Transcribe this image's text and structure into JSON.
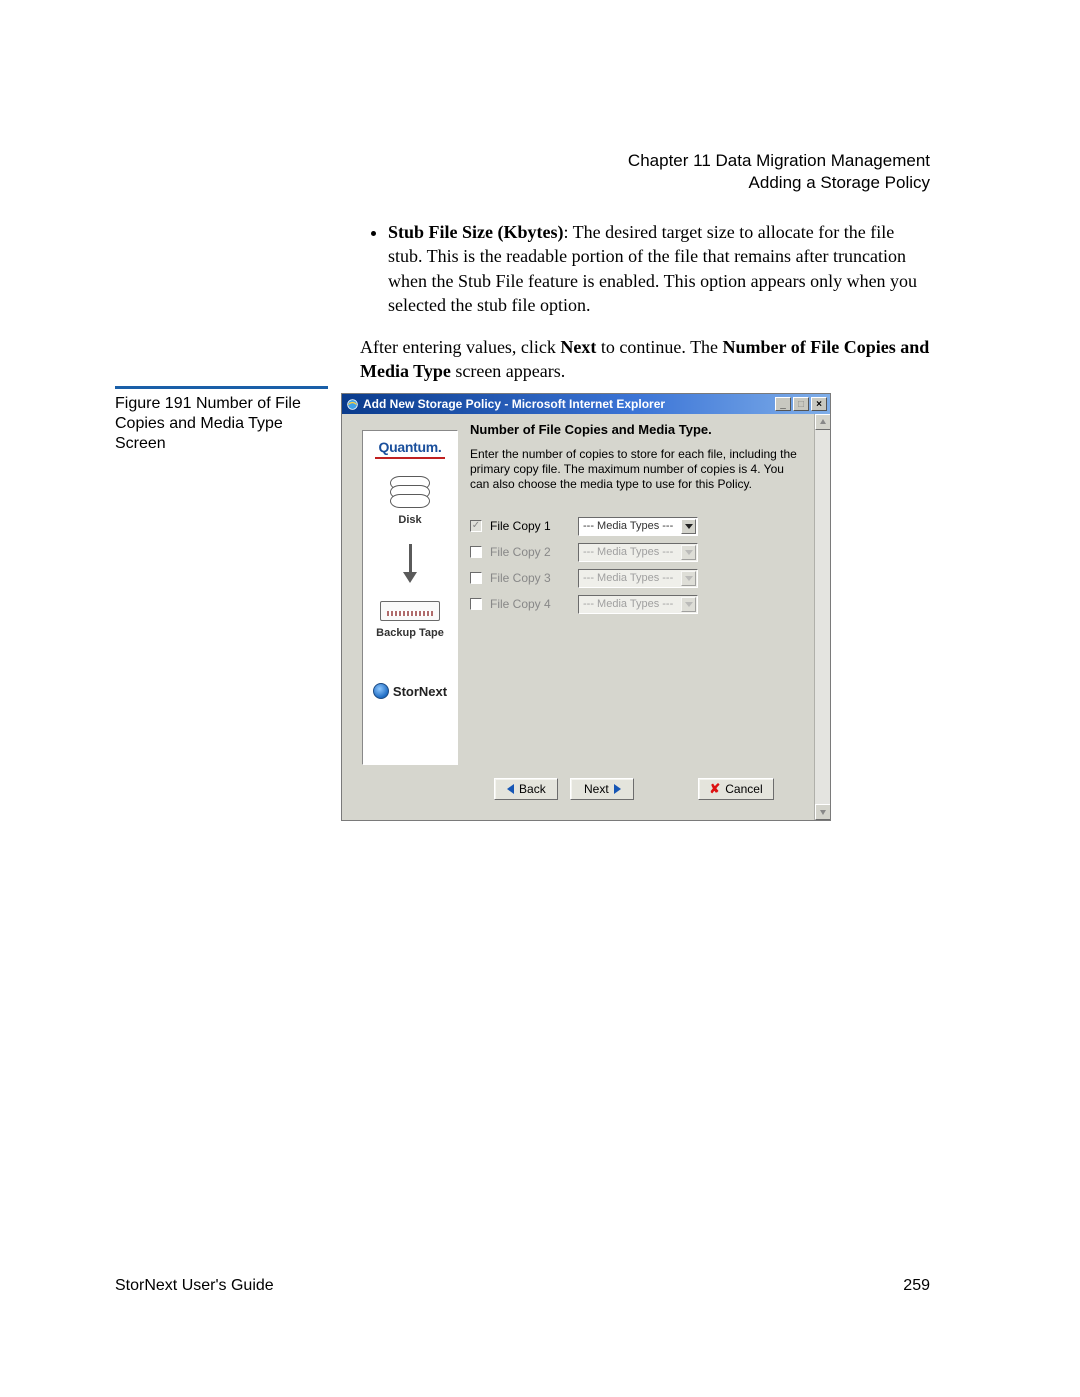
{
  "header": {
    "chapter": "Chapter 11  Data Migration Management",
    "section": "Adding a Storage Policy"
  },
  "body": {
    "bullet_label": "Stub File Size (Kbytes)",
    "bullet_text": ": The desired target size to allocate for the file stub. This is the readable portion of the file that remains after truncation when the Stub File feature is enabled. This option appears only when you selected the stub file option.",
    "para_pre": "After entering values, click ",
    "para_next": "Next",
    "para_mid": " to continue. The ",
    "para_bold": "Number of File Copies and Media Type",
    "para_post": " screen appears."
  },
  "figure": {
    "caption": "Figure 191  Number of File Copies and Media Type Screen"
  },
  "screenshot": {
    "title": "Add New Storage Policy - Microsoft Internet Explorer",
    "heading": "Number of File Copies and Media Type.",
    "description": "Enter the number of copies to store for each file, including the primary copy file. The maximum number of copies is 4. You can also choose the media type to use for this Policy.",
    "left": {
      "brand": "Quantum.",
      "disk_label": "Disk",
      "tape_label": "Backup Tape",
      "product": "StorNext"
    },
    "rows": [
      {
        "label": "File Copy 1",
        "media": "--- Media Types ---",
        "checked": true,
        "enabled": true
      },
      {
        "label": "File Copy 2",
        "media": "--- Media Types ---",
        "checked": false,
        "enabled": false
      },
      {
        "label": "File Copy 3",
        "media": "--- Media Types ---",
        "checked": false,
        "enabled": false
      },
      {
        "label": "File Copy 4",
        "media": "--- Media Types ---",
        "checked": false,
        "enabled": false
      }
    ],
    "buttons": {
      "back": "Back",
      "next": "Next",
      "cancel": "Cancel"
    }
  },
  "footer": {
    "guide": "StorNext User's Guide",
    "page": "259"
  }
}
